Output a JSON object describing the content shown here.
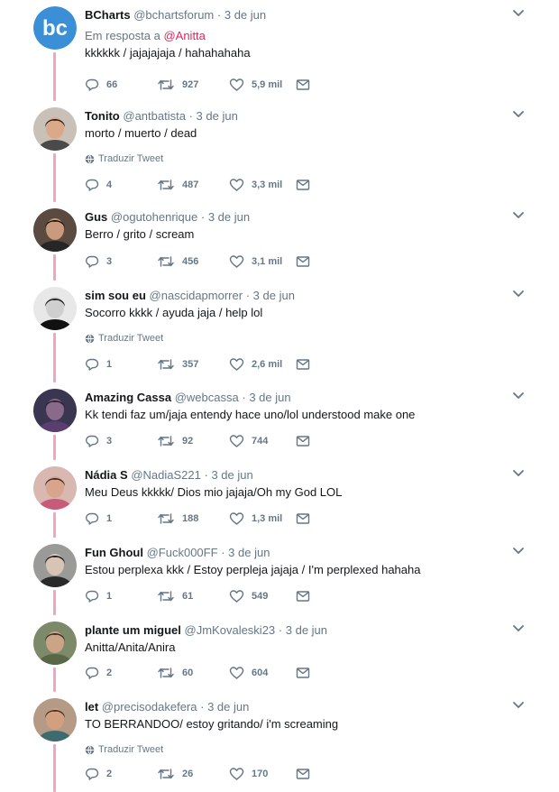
{
  "tweets": [
    {
      "name": "BCharts",
      "handle": "@bchartsforum",
      "date": "3 de jun",
      "reply_prefix": "Em resposta a",
      "reply_mention": "@Anitta",
      "text": "kkkkkk / jajajajaja / hahahahaha",
      "translate": "",
      "replies": "66",
      "retweets": "927",
      "likes": "5,9 mil",
      "avatar": {
        "type": "logo",
        "label": "bc",
        "color": "#3b8fd6"
      }
    },
    {
      "name": "Tonito",
      "handle": "@antbatista",
      "date": "3 de jun",
      "text": "morto / muerto / dead",
      "translate": "Traduzir Tweet",
      "replies": "4",
      "retweets": "487",
      "likes": "3,3 mil",
      "avatar": {
        "type": "photo",
        "bg": "#c9c1b8",
        "skin": "#d9a98a",
        "hair": "#2b2420",
        "shirt": "#4a4a4a"
      }
    },
    {
      "name": "Gus",
      "handle": "@ogutohenrique",
      "date": "3 de jun",
      "text": "Berro / grito / scream",
      "translate": "",
      "replies": "3",
      "retweets": "456",
      "likes": "3,1 mil",
      "avatar": {
        "type": "photo",
        "bg": "#5a4a40",
        "skin": "#c99a7c",
        "hair": "#1d1714",
        "shirt": "#262626"
      }
    },
    {
      "name": "sim sou eu",
      "handle": "@nascidapmorrer",
      "date": "3 de jun",
      "text": "Socorro kkkk / ayuda jaja / help lol",
      "translate": "Traduzir Tweet",
      "replies": "1",
      "retweets": "357",
      "likes": "2,6 mil",
      "avatar": {
        "type": "photo",
        "bg": "#e8e8e8",
        "skin": "#cfcfcf",
        "hair": "#1a1a1a",
        "shirt": "#111111"
      }
    },
    {
      "name": "Amazing Cassa",
      "handle": "@webcassa",
      "date": "3 de jun",
      "text": "Kk tendi faz um/jaja entendy hace uno/lol understood make one",
      "translate": "",
      "replies": "3",
      "retweets": "92",
      "likes": "744",
      "avatar": {
        "type": "photo",
        "bg": "#3a3550",
        "skin": "#8a6a8a",
        "hair": "#24202e",
        "shirt": "#5b3e70"
      }
    },
    {
      "name": "Nádia S",
      "handle": "@NadiaS221",
      "date": "3 de jun",
      "text": "Meu Deus kkkkk/ Dios mio jajaja/Oh my God LOL",
      "translate": "",
      "replies": "1",
      "retweets": "188",
      "likes": "1,3 mil",
      "avatar": {
        "type": "photo",
        "bg": "#d8b8b0",
        "skin": "#d8a48c",
        "hair": "#3a2a24",
        "shirt": "#c75b7a"
      }
    },
    {
      "name": "Fun Ghoul",
      "handle": "@Fuck000FF",
      "date": "3 de jun",
      "text": "Estou perplexa kkk /  Estoy perpleja jajaja / I'm perplexed hahaha",
      "translate": "",
      "replies": "1",
      "retweets": "61",
      "likes": "549",
      "avatar": {
        "type": "photo",
        "bg": "#9a9a98",
        "skin": "#d8c4b4",
        "hair": "#1a1a1a",
        "shirt": "#2a2a2a"
      }
    },
    {
      "name": "plante um miguel",
      "handle": "@JmKovaleski23",
      "date": "3 de jun",
      "text": "Anitta/Anita/Anira",
      "translate": "",
      "replies": "2",
      "retweets": "60",
      "likes": "604",
      "avatar": {
        "type": "photo",
        "bg": "#7d8a6a",
        "skin": "#c9a487",
        "hair": "#3a2e24",
        "shirt": "#5a6648"
      }
    },
    {
      "name": "let",
      "handle": "@precisodakefera",
      "date": "3 de jun",
      "text": "TO BERRANDOO/ estoy gritando/ i'm screaming",
      "translate": "Traduzir Tweet",
      "replies": "2",
      "retweets": "26",
      "likes": "170",
      "avatar": {
        "type": "photo",
        "bg": "#b59a86",
        "skin": "#d2a07f",
        "hair": "#4a2e20",
        "shirt": "#3d6b6e"
      }
    }
  ],
  "colors": {
    "thread": "#f2a4c0",
    "muted": "#657786",
    "mention": "#e0245e"
  },
  "icons": {
    "reply": "reply-bubble-icon",
    "retweet": "retweet-icon",
    "like": "heart-icon",
    "dm": "envelope-icon",
    "more": "chevron-down-icon",
    "globe": "globe-icon"
  }
}
